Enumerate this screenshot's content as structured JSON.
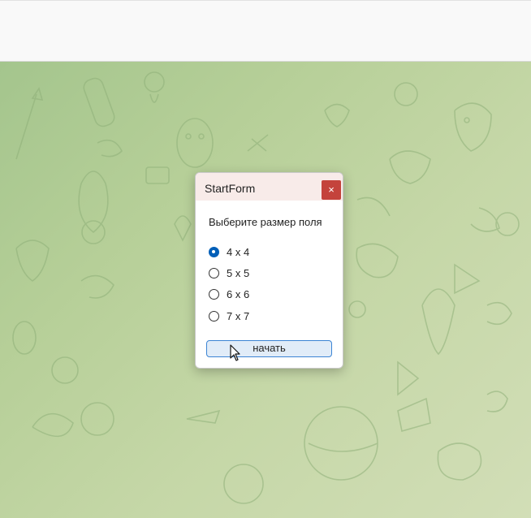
{
  "dialog": {
    "title": "StartForm",
    "close_glyph": "×",
    "prompt": "Выберите размер поля",
    "options": [
      {
        "label": "4 x 4",
        "checked": true
      },
      {
        "label": "5 x 5",
        "checked": false
      },
      {
        "label": "6 x 6",
        "checked": false
      },
      {
        "label": "7 x 7",
        "checked": false
      }
    ],
    "start_label": "начать"
  },
  "colors": {
    "close": "#c4433c",
    "radio_accent": "#005fb8",
    "button_border": "#3c84d4"
  },
  "icons": [
    "close-icon",
    "mouse-cursor-icon"
  ]
}
